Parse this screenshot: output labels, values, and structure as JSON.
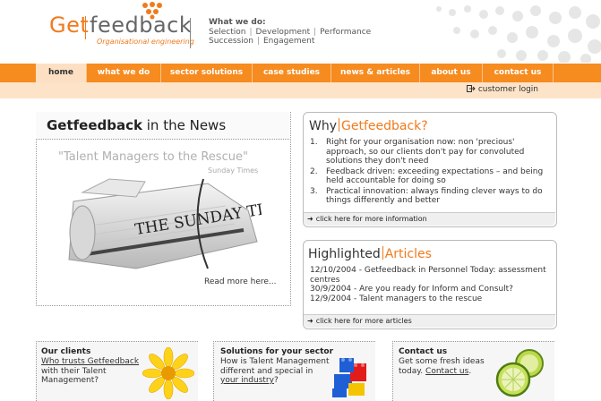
{
  "logo": {
    "get": "Get",
    "feedback": "feedback",
    "subtitle": "Organisational engineering"
  },
  "header": {
    "whatwedo_title": "What we do:",
    "services_line1": [
      "Selection",
      "Development",
      "Performance"
    ],
    "services_line2": [
      "Succession",
      "Engagement"
    ]
  },
  "nav": {
    "items": [
      "home",
      "what we do",
      "sector solutions",
      "case studies",
      "news & articles",
      "about us",
      "contact us"
    ]
  },
  "subnav": {
    "login": "customer login"
  },
  "news": {
    "title_bold": "Getfeedback",
    "title_rest": " in the News",
    "quote": "\"Talent Managers to the Rescue\"",
    "quote_source": "Sunday Times",
    "paper_masthead": "THE SUNDAY TIMES",
    "read_more": "Read more here..."
  },
  "why": {
    "title_a": "Why",
    "title_b": "Getfeedback?",
    "items": [
      "Right for your organisation now: non 'precious' approach, so our clients don't pay for convoluted solutions they don't need",
      "Feedback driven: exceeding expectations – and being held accountable for doing so",
      "Practical innovation: always finding clever ways to do things differently and better"
    ],
    "more": "click here for more information"
  },
  "articles": {
    "title_a": "Highlighted",
    "title_b": "Articles",
    "items": [
      "12/10/2004 - Getfeedback in Personnel Today: assessment centres",
      "30/9/2004 - Are you ready for Inform and Consult?",
      "12/9/2004 - Talent managers to the rescue"
    ],
    "more": "click here for more articles"
  },
  "bottom": {
    "clients_title": "Our clients",
    "clients_link": "Who trusts Getfeedback",
    "clients_text": "with their Talent Management?",
    "solutions_title": "Solutions for your sector",
    "solutions_text": "How is Talent Management different and special in",
    "solutions_link": "your industry",
    "solutions_end": "?",
    "contact_title": "Contact us",
    "contact_text": "Get some fresh ideas today.",
    "contact_link": "Contact us",
    "contact_end": "."
  },
  "colors": {
    "accent": "#f68b1f",
    "logo_orange": "#f07a1c",
    "nav_light": "#fde0c4"
  },
  "icons": [
    "logo-dots-icon",
    "login-arrow-icon",
    "more-arrow-icon",
    "newspaper-image",
    "daisy-flower-image",
    "lego-blocks-image",
    "lime-slices-image"
  ]
}
